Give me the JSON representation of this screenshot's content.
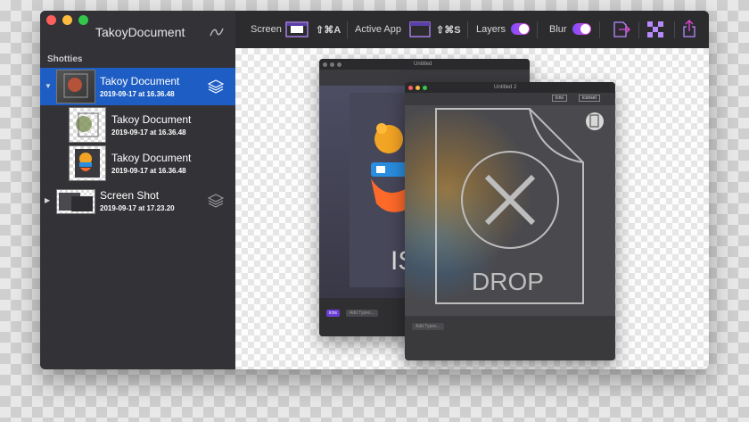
{
  "app": {
    "title": "TakoyDocument"
  },
  "sidebar": {
    "section": "Shotties",
    "items": [
      {
        "title": "Takoy Document",
        "date": "2019-09-17 at 16.36.48"
      },
      {
        "title": "Takoy Document",
        "date": "2019-09-17 at 16.36.48"
      },
      {
        "title": "Takoy Document",
        "date": "2019-09-17 at 16.36.48"
      },
      {
        "title": "Screen Shot",
        "date": "2019-09-17 at 17.23.20"
      }
    ]
  },
  "toolbar": {
    "screen_label": "Screen",
    "screen_shortcut": "⇧⌘A",
    "active_app_label": "Active App",
    "active_app_shortcut": "⇧⌘S",
    "layers_label": "Layers",
    "blur_label": "Blur",
    "layers_on": true,
    "blur_on": true
  },
  "canvas": {
    "back_window_title": "Untitled",
    "front_window_title": "Untitled 2",
    "front_tag_1": "icns",
    "front_tag_2": "iconset",
    "back_tag": "icns",
    "add_types": "Add Types...",
    "back_logo_text": "IS",
    "drop_text": "DROP"
  },
  "colors": {
    "selection": "#1e5ec4",
    "toggle_start": "#7a4dff",
    "toggle_end": "#e44ad8"
  }
}
